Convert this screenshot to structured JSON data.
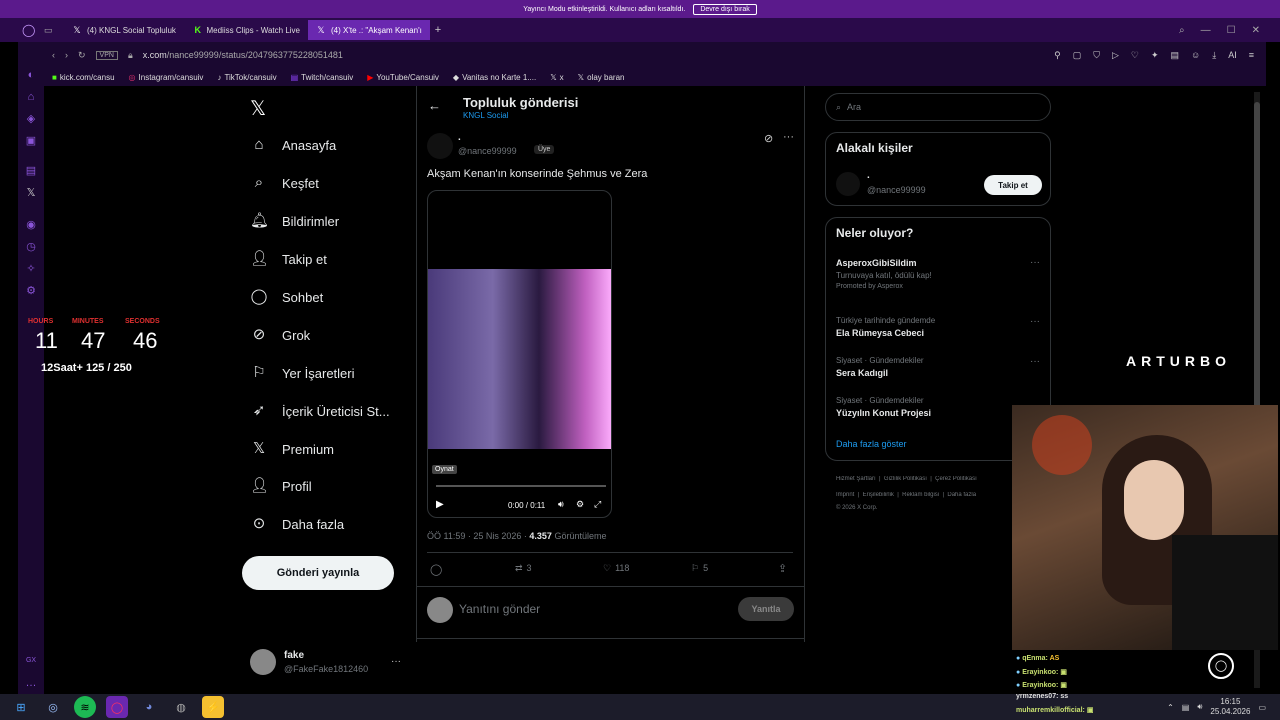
{
  "notice": {
    "text": "Yayıncı Modu etkinleştirildi. Kullanıcı adları kısaltıldı.",
    "button": "Devre dışı bırak"
  },
  "tabs": [
    {
      "label": "(4) KNGL Social Topluluk",
      "icon": "x-icon"
    },
    {
      "label": "Mediiss Clips - Watch Live",
      "icon": "kick-icon"
    },
    {
      "label": "(4) X'te .: \"Akşam Kenan'ı",
      "icon": "x-icon"
    }
  ],
  "address": {
    "vpn": "VPN",
    "url_host": "x.com",
    "url_path": "/nance99999/status/2047963775228051481"
  },
  "bookmarks": [
    "kick.com/cansu",
    "Instagram/cansuiv",
    "TikTok/cansuiv",
    "Twitch/cansuiv",
    "YouTube/Cansuiv",
    "Vanitas no Karte 1....",
    "x",
    "olay baran"
  ],
  "timer": {
    "hours_label": "HOURS",
    "minutes_label": "MINUTES",
    "seconds_label": "SECONDS",
    "hours": "11",
    "minutes": "47",
    "seconds": "46",
    "goal": "12Saat+ 125 / 250"
  },
  "nav": {
    "items": [
      "Anasayfa",
      "Keşfet",
      "Bildirimler",
      "Takip et",
      "Sohbet",
      "Grok",
      "Yer İşaretleri",
      "İçerik Üreticisi St...",
      "Premium",
      "Profil",
      "Daha fazla"
    ],
    "post_button": "Gönderi yayınla",
    "account_name": "fake",
    "account_handle": "@FakeFake1812460"
  },
  "post": {
    "header_title": "Topluluk gönderisi",
    "header_sub": "KNGL Social",
    "author_name": ".",
    "author_handle": "@nance99999",
    "badge": "Üye",
    "text": "Akşam Kenan'ın konserinde Şehmus ve Zera",
    "video_tooltip": "Oynat",
    "video_time": "0:00 / 0:11",
    "meta_time": "ÖÖ 11:59 · 25 Nis 2026 ·",
    "views": "4.357",
    "views_label": "Görüntüleme",
    "retweets": "3",
    "likes": "118",
    "bookmarks": "5",
    "reply_placeholder": "Yanıtını gönder",
    "reply_button": "Yanıtla"
  },
  "right": {
    "search_placeholder": "Ara",
    "related_title": "Alakalı kişiler",
    "related_name": ".",
    "related_handle": "@nance99999",
    "follow_button": "Takip et",
    "trends_title": "Neler oluyor?",
    "trends": [
      {
        "category": "",
        "name": "AsperoxGibiSildim",
        "desc": "Turnuvaya katıl, ödülü kap!",
        "promo": "Promoted by Asperox"
      },
      {
        "category": "Türkiye tarihinde gündemde",
        "name": "Ela Rümeysa Cebeci"
      },
      {
        "category": "Siyaset · Gündemdekiler",
        "name": "Sera Kadıgil"
      },
      {
        "category": "Siyaset · Gündemdekiler",
        "name": "Yüzyılın Konut Projesi"
      }
    ],
    "show_more": "Daha fazla göster",
    "footer1": "Hizmet Şartları  |  Gizlilik Politikası  |  Çerez Politikası",
    "footer2": "Imprint  |  Erişilebilirlik  |  Reklam bilgisi  |  Daha fazla",
    "footer3": "© 2026 X Corp."
  },
  "overlay": {
    "brand": "ARTURBO"
  },
  "chat": [
    {
      "user": "qEnma",
      "msg": "AS"
    },
    {
      "user": "Erayinkoo",
      "msg": ""
    },
    {
      "user": "Erayinkoo",
      "msg": ""
    },
    {
      "user": "yrmzenes07",
      "msg": "ss"
    },
    {
      "user": "muharremkillofficial",
      "msg": ""
    }
  ],
  "clock": {
    "time": "16:15",
    "date": "25.04.2026"
  },
  "colors": {
    "accent": "#1d9bf0",
    "browser_purple": "#6a28b0",
    "timer_red": "#e03030"
  }
}
